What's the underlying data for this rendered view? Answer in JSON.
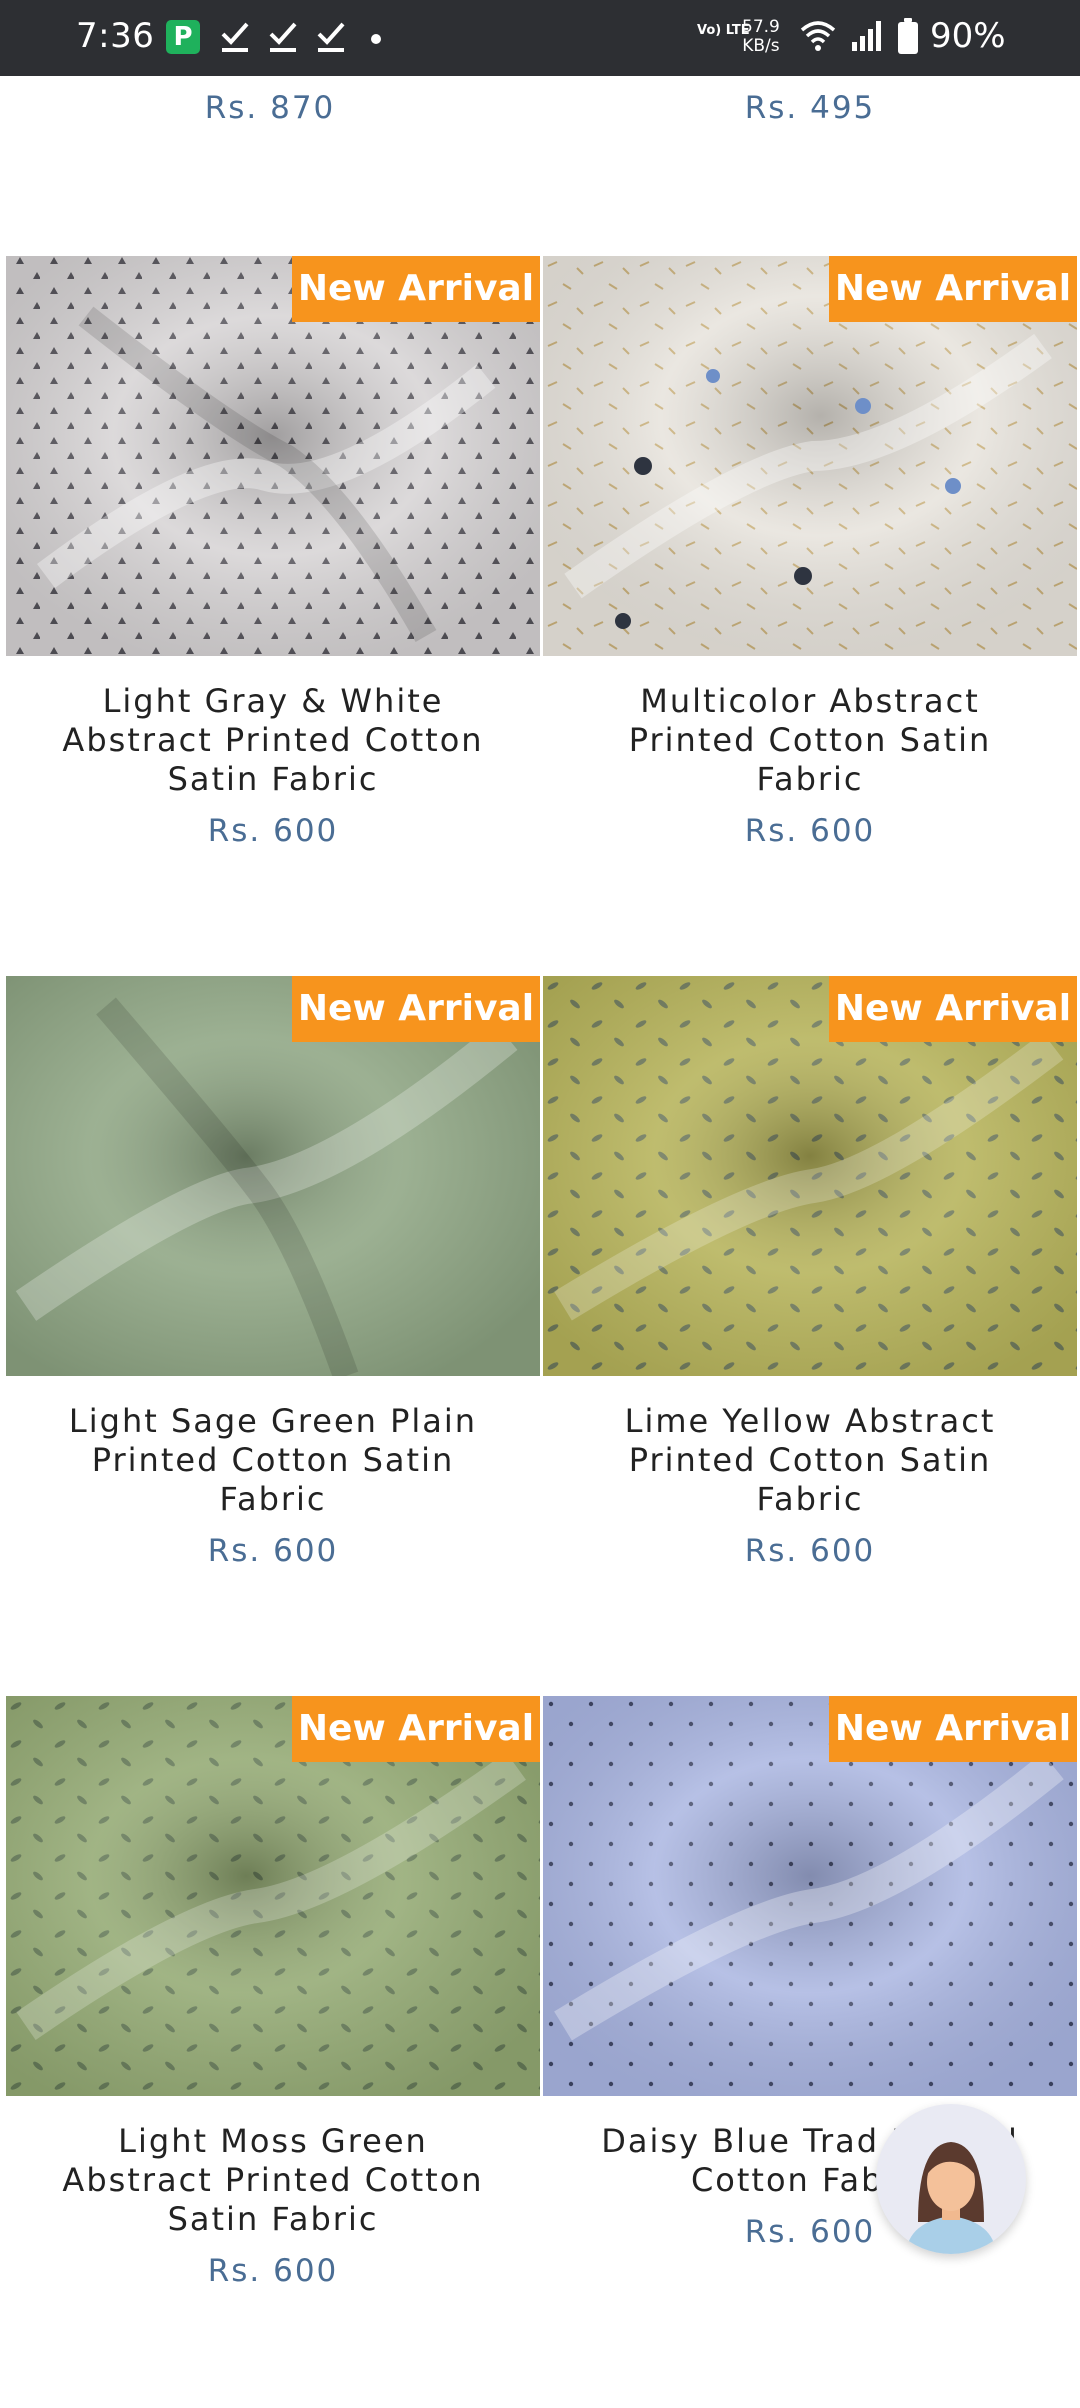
{
  "status_bar": {
    "time": "7:36",
    "pay_icon_letter": "P",
    "network_label": "Vo) LTE",
    "speed_value": "57.9",
    "speed_unit": "KB/s",
    "battery_percent": "90%"
  },
  "top_prices": [
    "Rs. 870",
    "Rs. 495"
  ],
  "badge_label": "New Arrival",
  "products": [
    {
      "name": "Light Gray & White Abstract Printed Cotton Satin Fabric",
      "price": "Rs. 600",
      "swatch": "#d6d3d4",
      "pattern": "#55535a"
    },
    {
      "name": "Multicolor Abstract Printed Cotton Satin Fabric",
      "price": "Rs. 600",
      "swatch": "#e7e3dc",
      "pattern": "#c9b07a"
    },
    {
      "name": "Light Sage Green Plain Printed Cotton Satin Fabric",
      "price": "Rs. 600",
      "swatch": "#8fa684",
      "pattern": "#7f9676"
    },
    {
      "name": "Lime Yellow Abstract Printed Cotton Satin Fabric",
      "price": "Rs. 600",
      "swatch": "#b6b35a",
      "pattern": "#6f7a5c"
    },
    {
      "name": "Light Moss Green Abstract Printed Cotton Satin Fabric",
      "price": "Rs. 600",
      "swatch": "#94aa74",
      "pattern": "#657a58"
    },
    {
      "name": "Daisy Blue Trad Printed Cotton Fabric",
      "price": "Rs. 600",
      "swatch": "#a7b3e0",
      "pattern": "#3e4564"
    }
  ]
}
